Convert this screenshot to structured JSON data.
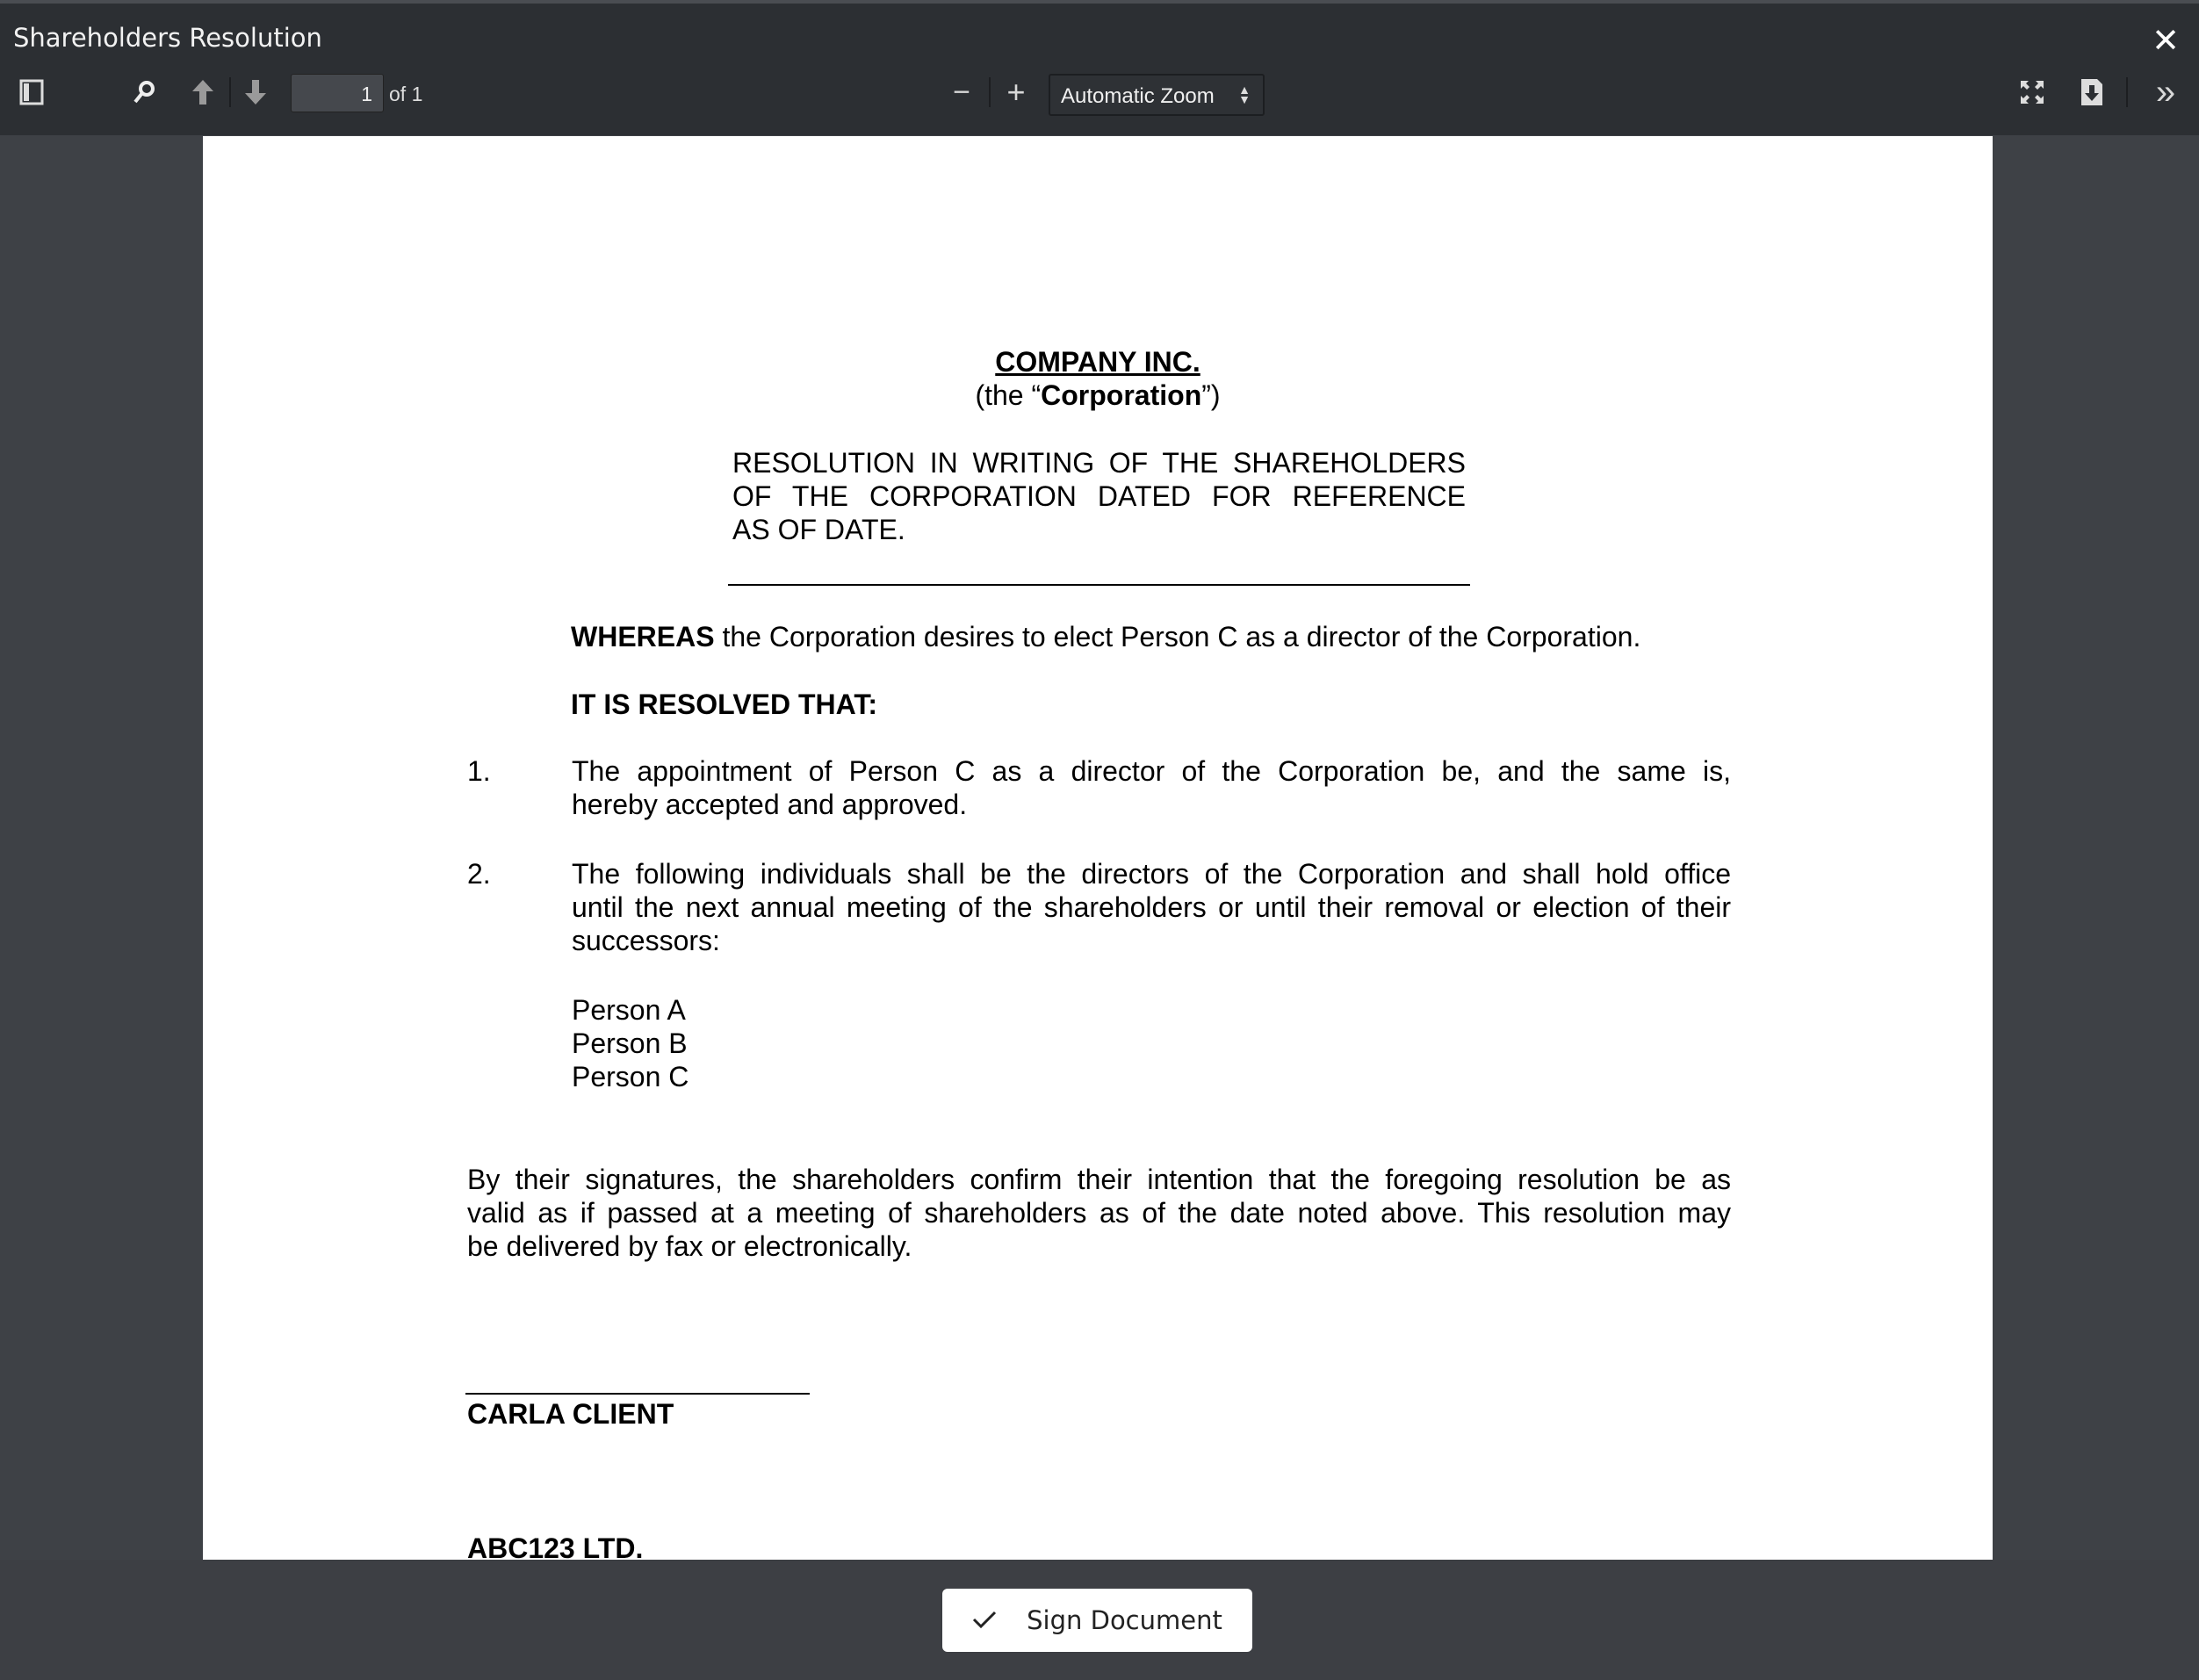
{
  "window": {
    "title": "Shareholders Resolution",
    "close_icon": "close-icon"
  },
  "toolbar": {
    "page_number": "1",
    "page_count_label": "of 1",
    "zoom_value": "Automatic Zoom",
    "zoom_out": "−",
    "zoom_in": "+",
    "next_more": "»"
  },
  "document": {
    "company": "COMPANY INC.",
    "the_prefix": "(the “",
    "corp_bold": "Corporation",
    "the_suffix": "”)",
    "resolution_lines": [
      "RESOLUTION IN WRITING OF THE SHAREHOLDERS",
      "OF THE CORPORATION DATED FOR REFERENCE",
      "AS OF DATE."
    ],
    "whereas_bold": "WHEREAS",
    "whereas_text": " the Corporation desires to elect Person C as a director of the Corporation.",
    "resolved": "IT IS RESOLVED THAT:",
    "items": [
      {
        "num": "1.",
        "lines": [
          "The appointment of Person C as a director of the Corporation be, and the same is,",
          "hereby accepted and approved."
        ]
      },
      {
        "num": "2.",
        "lines": [
          "The following individuals shall be the directors of the Corporation and shall hold office",
          "until the next annual meeting of the shareholders or until their removal or election of their",
          "successors:"
        ]
      }
    ],
    "directors": [
      "Person A",
      "Person B",
      "Person C"
    ],
    "closing_lines": [
      "By their signatures, the shareholders confirm their intention that the foregoing resolution be as",
      "valid as if passed at a meeting of shareholders as of the date noted above. This resolution may",
      "be delivered by fax or electronically."
    ],
    "signatories": [
      "CARLA CLIENT",
      "ABC123 LTD."
    ]
  },
  "footer": {
    "sign_label": "Sign Document"
  }
}
